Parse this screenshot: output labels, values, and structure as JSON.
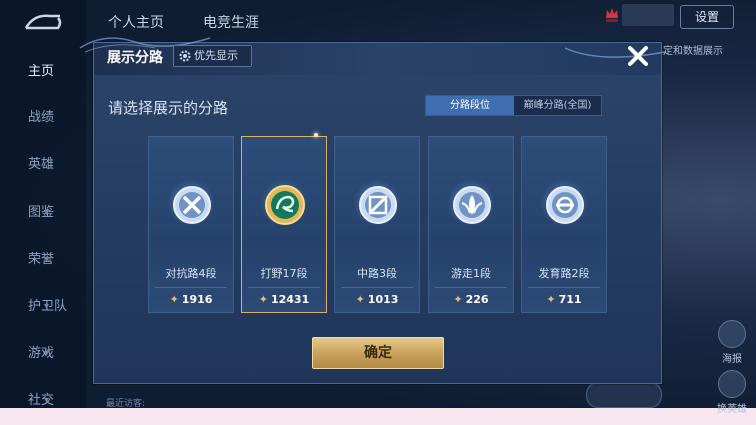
{
  "header": {
    "tabs": [
      "个人主页",
      "电竞生涯"
    ],
    "settings_label": "设置",
    "right_peek_text": "定和数据展示"
  },
  "sidebar": {
    "items": [
      {
        "label": "主页",
        "active": true,
        "chevron": false
      },
      {
        "label": "战绩",
        "active": false,
        "chevron": false
      },
      {
        "label": "英雄",
        "active": false,
        "chevron": false
      },
      {
        "label": "图鉴",
        "active": false,
        "chevron": true
      },
      {
        "label": "荣誉",
        "active": false,
        "chevron": true
      },
      {
        "label": "护卫队",
        "active": false,
        "chevron": true
      },
      {
        "label": "游戏",
        "active": false,
        "chevron": true
      },
      {
        "label": "社交",
        "active": false,
        "chevron": true
      }
    ]
  },
  "right_buttons": [
    {
      "label": "海报",
      "icon": "poster-icon"
    },
    {
      "label": "换英雄",
      "icon": "swap-hero-icon"
    }
  ],
  "visitors_label": "最近访客:",
  "dialog": {
    "title": "展示分路",
    "preference_button": "优先显示",
    "subtitle": "请选择展示的分路",
    "toggle": {
      "options": [
        "分路段位",
        "巅峰分路(全国)"
      ],
      "selected": 0
    },
    "confirm_label": "确定",
    "cards": [
      {
        "label": "对抗路4段",
        "score": "1916",
        "icon": "clash-lane-icon",
        "selected": false
      },
      {
        "label": "打野17段",
        "score": "12431",
        "icon": "jungle-dragon-icon",
        "selected": true
      },
      {
        "label": "中路3段",
        "score": "1013",
        "icon": "mid-lane-icon",
        "selected": false
      },
      {
        "label": "游走1段",
        "score": "226",
        "icon": "roam-icon",
        "selected": false
      },
      {
        "label": "发育路2段",
        "score": "711",
        "icon": "farm-lane-icon",
        "selected": false
      }
    ]
  },
  "colors": {
    "accent_gold": "#d9b16b",
    "toggle_active": "#3e6eb0",
    "dialog_bg": "#26426b"
  }
}
